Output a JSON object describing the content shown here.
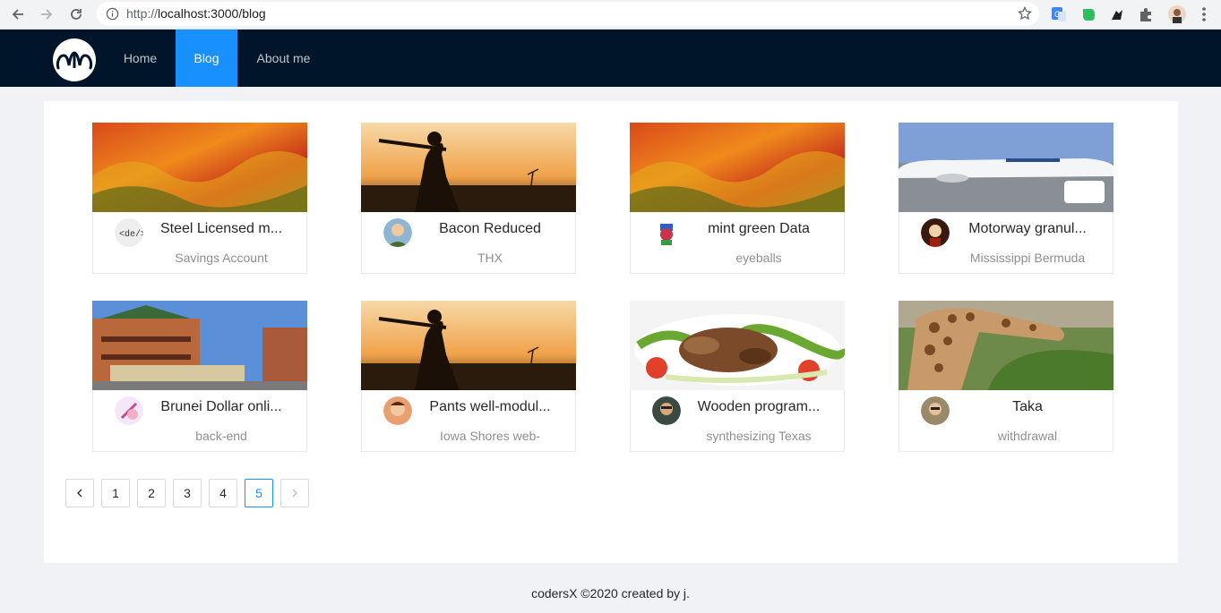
{
  "browser": {
    "url_scheme": "http://",
    "url_rest": "localhost:3000/blog"
  },
  "nav": {
    "items": [
      {
        "label": "Home"
      },
      {
        "label": "Blog"
      },
      {
        "label": "About me"
      }
    ],
    "active_index": 1,
    "accent_color": "#1890ff",
    "header_color": "#001529"
  },
  "posts": [
    {
      "title": "Steel Licensed m...",
      "description": "Savings Account",
      "cover": "abstract-fire",
      "avatar": "code-tag-avatar"
    },
    {
      "title": "Bacon Reduced",
      "description": "THX",
      "cover": "cricket-silhouette",
      "avatar": "person-avatar"
    },
    {
      "title": "mint green Data",
      "description": "eyeballs",
      "cover": "abstract-fire",
      "avatar": "cartoon-avatar"
    },
    {
      "title": "Motorway granul...",
      "description": "Mississippi Bermuda",
      "cover": "airplane",
      "avatar": "person-avatar"
    },
    {
      "title": "Brunei Dollar onli...",
      "description": "back-end",
      "cover": "city-street",
      "avatar": "illustration-avatar"
    },
    {
      "title": "Pants well-modul...",
      "description": "Iowa Shores web-",
      "cover": "cricket-silhouette",
      "avatar": "person-avatar"
    },
    {
      "title": "Wooden program...",
      "description": "synthesizing Texas",
      "cover": "food-salad",
      "avatar": "person-avatar"
    },
    {
      "title": "Taka",
      "description": "withdrawal",
      "cover": "giraffe",
      "avatar": "person-avatar"
    }
  ],
  "pagination": {
    "prev_icon": "chevron-left-icon",
    "pages": [
      "1",
      "2",
      "3",
      "4",
      "5"
    ],
    "current": "5",
    "next_icon": "chevron-right-icon"
  },
  "footer": {
    "text": "codersX ©2020 created by j."
  }
}
